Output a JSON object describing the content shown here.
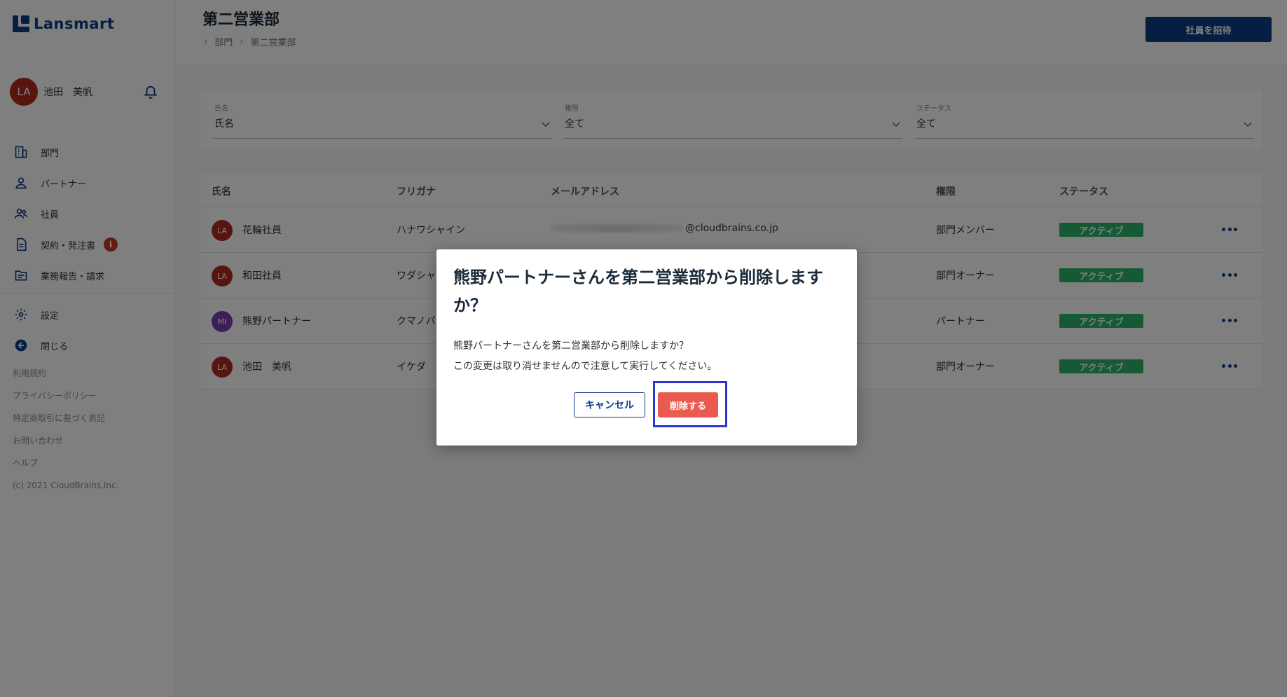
{
  "app": {
    "logo_text": "Lansmart"
  },
  "user": {
    "initials": "LA",
    "name": "池田　美帆"
  },
  "sidebar": {
    "nav": [
      {
        "label": "部門",
        "icon": "building-icon"
      },
      {
        "label": "パートナー",
        "icon": "person-icon"
      },
      {
        "label": "社員",
        "icon": "people-icon"
      },
      {
        "label": "契約・発注書",
        "icon": "document-icon",
        "alert": "i"
      },
      {
        "label": "業務報告・請求",
        "icon": "folder-icon"
      }
    ],
    "nav2": [
      {
        "label": "設定",
        "icon": "gear-icon"
      },
      {
        "label": "閉じる",
        "icon": "collapse-icon"
      }
    ],
    "footer_links": [
      "利用規約",
      "プライバシーポリシー",
      "特定商取引に基づく表記",
      "お問い合わせ",
      "ヘルプ",
      "(c) 2021 CloudBrains,Inc."
    ]
  },
  "header": {
    "title": "第二営業部",
    "breadcrumb": [
      "部門",
      "第二営業部"
    ],
    "invite_label": "社員を招待"
  },
  "filters": [
    {
      "label": "氏名",
      "value": "氏名"
    },
    {
      "label": "権限",
      "value": "全て"
    },
    {
      "label": "ステータス",
      "value": "全て"
    }
  ],
  "table": {
    "columns": [
      "氏名",
      "フリガナ",
      "メールアドレス",
      "権限",
      "ステータス"
    ],
    "rows": [
      {
        "initials": "LA",
        "avatar_color": "#b12b1f",
        "name": "花輪社員",
        "kana": "ハナワシャイン",
        "email": "@cloudbrains.co.jp",
        "role": "部門メンバー",
        "status": "アクティブ"
      },
      {
        "initials": "LA",
        "avatar_color": "#b12b1f",
        "name": "和田社員",
        "kana": "ワダシャ",
        "email": "",
        "role": "部門オーナー",
        "status": "アクティブ"
      },
      {
        "initials": "MI",
        "avatar_color": "#7a3fb0",
        "name": "熊野パートナー",
        "kana": "クマノパ",
        "email": "",
        "role": "パートナー",
        "status": "アクティブ"
      },
      {
        "initials": "LA",
        "avatar_color": "#b12b1f",
        "name": "池田　美帆",
        "kana": "イケダ",
        "email": "",
        "role": "部門オーナー",
        "status": "アクティブ"
      }
    ]
  },
  "dialog": {
    "title": "熊野パートナーさんを第二営業部から削除しますか？",
    "body_line1": "熊野パートナーさんを第二営業部から削除しますか？",
    "body_line2": "この変更は取り消せませんので注意して実行してください。",
    "cancel_label": "キャンセル",
    "delete_label": "削除する"
  },
  "colors": {
    "brand": "#0b3f86",
    "status_active": "#2ab56a",
    "danger": "#ea5a4f",
    "highlight_frame": "#2d35d1"
  }
}
